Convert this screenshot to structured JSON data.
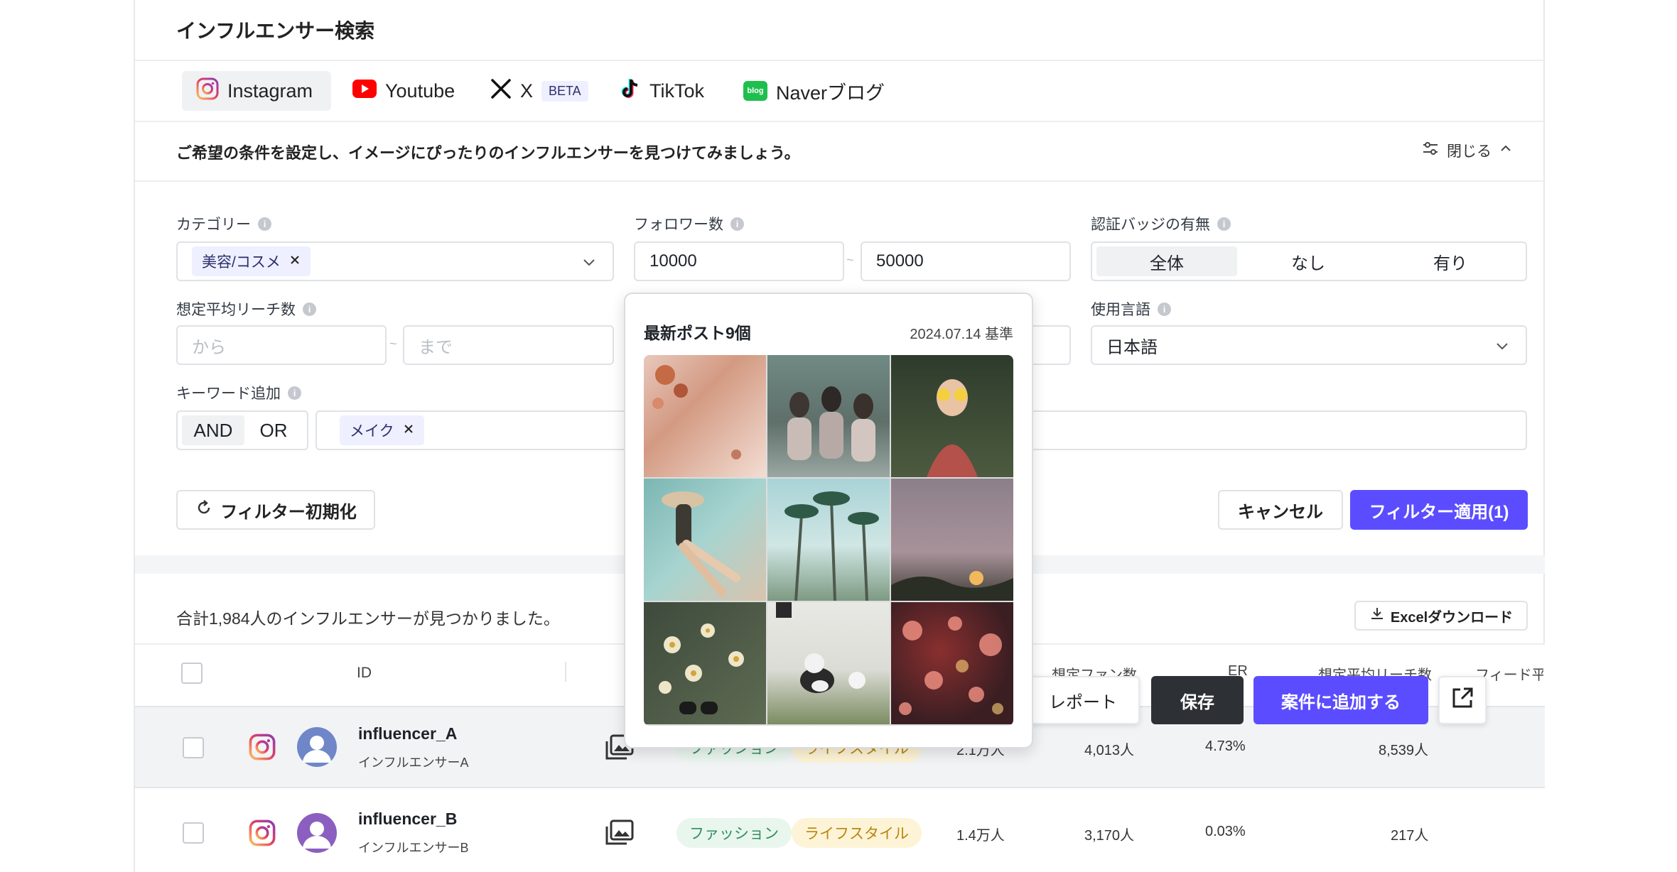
{
  "app": {
    "title": "インフルエンサー検索"
  },
  "tabs": [
    {
      "label": "Instagram",
      "icon": "instagram-icon",
      "active": true
    },
    {
      "label": "Youtube",
      "icon": "youtube-icon"
    },
    {
      "label": "X",
      "icon": "x-logo-icon",
      "badge": "BETA"
    },
    {
      "label": "TikTok",
      "icon": "tiktok-icon"
    },
    {
      "label": "Naverブログ",
      "icon": "naver-blog-icon",
      "icon_text": "blog"
    }
  ],
  "filter_intro": "ご希望の条件を設定し、イメージにぴったりのインフルエンサーを見つけてみましょう。",
  "close_label": "閉じる",
  "filters": {
    "category": {
      "label": "カテゴリー",
      "chips": [
        "美容/コスメ"
      ]
    },
    "followers": {
      "label": "フォロワー数",
      "from": "10000",
      "to": "50000",
      "sep": "~"
    },
    "badge": {
      "label": "認証バッジの有無",
      "options": [
        "全体",
        "なし",
        "有り"
      ],
      "selected": "全体"
    },
    "reach": {
      "label": "想定平均リーチ数",
      "from_placeholder": "から",
      "to_placeholder": "まで",
      "sep": "~"
    },
    "language": {
      "label": "使用言語",
      "value": "日本語"
    },
    "keyword": {
      "label": "キーワード追加",
      "and_label": "AND",
      "or_label": "OR",
      "chips": [
        "メイク"
      ]
    }
  },
  "buttons": {
    "reset": "フィルター初期化",
    "cancel": "キャンセル",
    "apply": "フィルター適用(1)",
    "excel": "Excelダウンロード",
    "report": "レポート",
    "save": "保存",
    "add_to_project": "案件に追加する"
  },
  "results": {
    "summary": "合計1,984人のインフルエンサーが見つかりました。"
  },
  "table": {
    "headers": {
      "id": "ID",
      "fans": "想定ファン数",
      "er": "ER",
      "reach": "想定平均リーチ数",
      "feed": "フィード平"
    },
    "rows": [
      {
        "handle": "influencer_A",
        "name": "インフルエンサーA",
        "tags": [
          "ファッション",
          "ライフスタイル"
        ],
        "followers": "2.1万人",
        "fans": "4,013人",
        "er": "4.73%",
        "reach": "8,539人"
      },
      {
        "handle": "influencer_B",
        "name": "インフルエンサーB",
        "tags": [
          "ファッション",
          "ライフスタイル"
        ],
        "followers": "1.4万人",
        "fans": "3,170人",
        "er": "0.03%",
        "reach": "217人"
      }
    ]
  },
  "popup": {
    "title": "最新ポスト9個",
    "date": "2024.07.14 基準"
  },
  "colors": {
    "accent": "#5b4dff",
    "dark_button": "#2d3136",
    "tag_green_bg": "#e9f6ee",
    "tag_green_fg": "#2f8f5b",
    "tag_yellow_bg": "#fdf3d6",
    "tag_yellow_fg": "#b8860b"
  }
}
